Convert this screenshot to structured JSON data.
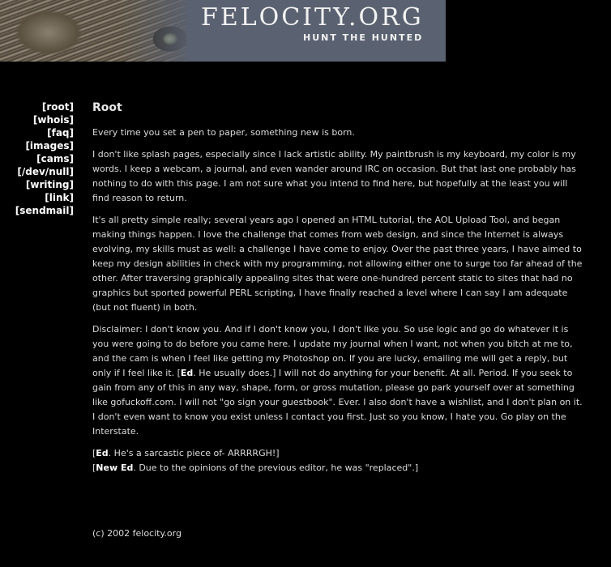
{
  "header": {
    "site_title": "FELOCITY.ORG",
    "tagline": "HUNT THE HUNTED"
  },
  "nav": {
    "items": [
      {
        "label": "[root]"
      },
      {
        "label": "[whois]"
      },
      {
        "label": "[faq]"
      },
      {
        "label": "[images]"
      },
      {
        "label": "[cams]"
      },
      {
        "label": "[/dev/null]"
      },
      {
        "label": "[writing]"
      },
      {
        "label": "[link]"
      },
      {
        "label": "[sendmail]"
      }
    ]
  },
  "main": {
    "title": "Root",
    "intro": "Every time you set a pen to paper, something new is born.",
    "para1": "I don't like splash pages, especially since I lack artistic ability. My paintbrush is my keyboard, my color is my words. I keep a webcam, a journal, and even wander around IRC on occasion. But that last one probably has nothing to do with this page. I am not sure what you intend to find here, but hopefully at the least you will find reason to return.",
    "para2": "It's all pretty simple really; several years ago I opened an HTML tutorial, the AOL Upload Tool, and began making things happen. I love the challenge that comes from web design, and since the Internet is always evolving, my skills must as well: a challenge I have come to enjoy. Over the past three years, I have aimed to keep my design abilities in check with my programming, not allowing either one to surge too far ahead of the other. After traversing graphically appealing sites that were one-hundred percent static to sites that had no graphics but sported powerful PERL scripting, I have finally reached a level where I can say I am adequate (but not fluent) in both.",
    "disclaimer_a": "Disclaimer: I don't know you. And if I don't know you, I don't like you. So use logic and go do whatever it is you were going to do before you came here. I update my journal when I want, not when you bitch at me to, and the cam is when I feel like getting my Photoshop on. If you are lucky, emailing me will get a reply, but only if I feel like it. [",
    "disclaimer_ed": "Ed",
    "disclaimer_b": ". He usually does.] I will not do anything for your benefit. At all. Period. If you seek to gain from any of this in any way, shape, form, or gross mutation, please go park yourself over at something like gofuckoff.com. I will not \"go sign your guestbook\". Ever. I also don't have a wishlist, and I don't plan on it. I don't even want to know you exist unless I contact you first. Just so you know, I hate you. Go play on the Interstate.",
    "ed_note_open": "[",
    "ed_note_label": "Ed",
    "ed_note_text": ". He's a sarcastic piece of- ARRRRGH!]",
    "new_ed_open": "[",
    "new_ed_label": "New Ed",
    "new_ed_text": ". Due to the opinions of the previous editor, he was \"replaced\".]"
  },
  "footer": {
    "copyright": "(c) 2002 felocity.org"
  }
}
